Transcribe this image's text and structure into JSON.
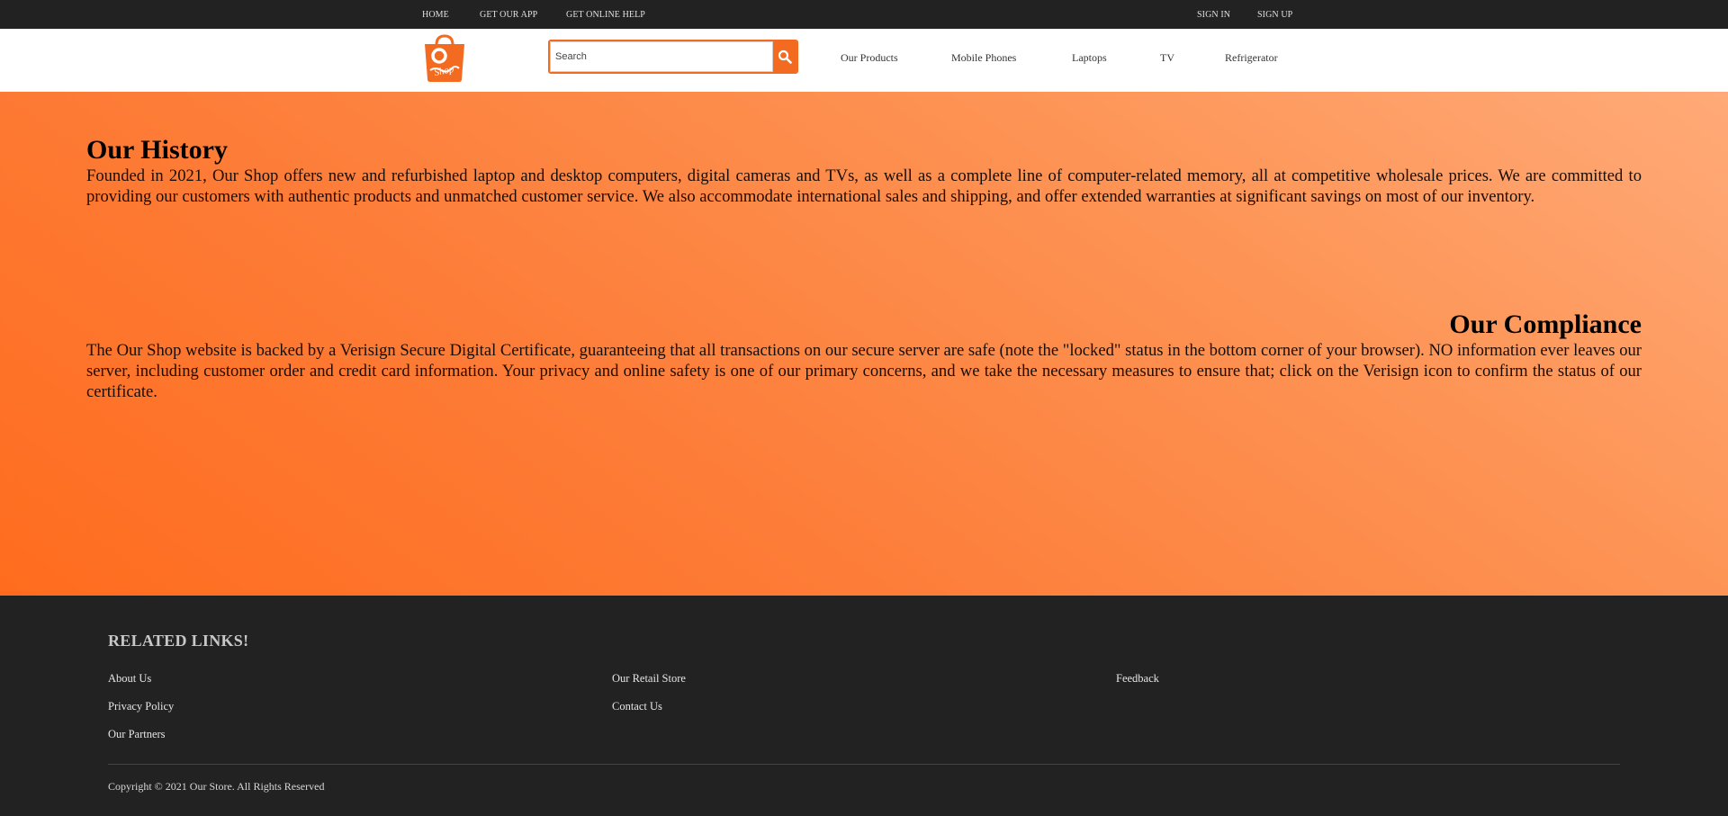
{
  "topbar": {
    "left_links": [
      "HOME",
      "GET OUR APP",
      "GET ONLINE HELP"
    ],
    "right_links": [
      "SIGN IN",
      "SIGN UP"
    ]
  },
  "header": {
    "logo_text": "Shop",
    "search": {
      "placeholder": "Search",
      "value": ""
    },
    "nav": [
      "Our Products",
      "Mobile Phones",
      "Laptops",
      "TV",
      "Refrigerator"
    ]
  },
  "main": {
    "history": {
      "title": "Our History",
      "body": "Founded in 2021, Our Shop offers new and refurbished laptop and desktop computers, digital cameras and TVs, as well as a complete line of computer-related memory, all at competitive wholesale prices. We are committed to providing our customers with authentic products and unmatched customer service. We also accommodate international sales and shipping, and offer extended warranties at significant savings on most of our inventory."
    },
    "compliance": {
      "title": "Our Compliance",
      "body": "The Our Shop website is backed by a Verisign Secure Digital Certificate, guaranteeing that all transactions on our secure server are safe (note the \"locked\" status in the bottom corner of your browser). NO information ever leaves our server, including customer order and credit card information. Your privacy and online safety is one of our primary concerns, and we take the necessary measures to ensure that; click on the Verisign icon to confirm the status of our certificate."
    }
  },
  "footer": {
    "title": "RELATED LINKS!",
    "col1": [
      "About Us",
      "Privacy Policy",
      "Our Partners"
    ],
    "col2": [
      "Our Retail Store",
      "Contact Us"
    ],
    "col3": [
      "Feedback"
    ],
    "copyright": "Copyright © 2021 Our Store. All Rights Reserved"
  },
  "colors": {
    "accent": "#f26b21",
    "dark_bar": "#222222"
  },
  "icons": [
    "shop-bag-logo",
    "search-icon"
  ]
}
